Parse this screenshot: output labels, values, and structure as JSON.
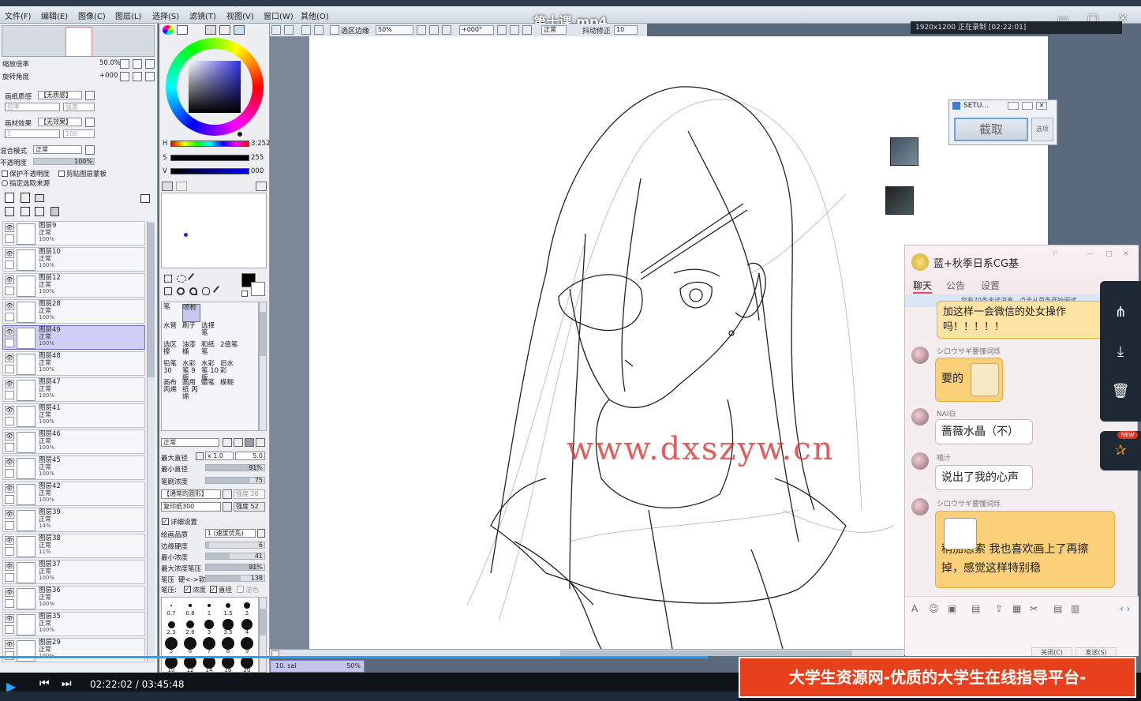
{
  "window": {
    "video_title": "第十课.mp4",
    "minimize": "▭",
    "maximize": "□",
    "close": "✕"
  },
  "menu": [
    "文件(F)",
    "编辑(E)",
    "图像(C)",
    "图层(L)",
    "选择(S)",
    "滤镜(T)",
    "视图(V)",
    "窗口(W)",
    "其他(O)"
  ],
  "toolbar": {
    "select_edge": "选区边缘",
    "zoom": "50%",
    "rotation": "+000°",
    "mode": "正常",
    "stabilizer_label": "抖动修正",
    "stabilizer_value": "10"
  },
  "recorder": {
    "text": "1920x1200  正在录制 [02:22:01]"
  },
  "navigator": {
    "zoom_label": "缩放倍率",
    "zoom_value": "50.0%",
    "rotate_label": "旋转角度",
    "rotate_value": "+000"
  },
  "paper": {
    "texture_label": "画纸质感",
    "texture_value": "【无质感】",
    "scale_label": "倍率",
    "scale_value": "100%",
    "strength_label": "强度",
    "strength_value": "20",
    "effect_label": "画材效果",
    "effect_value": "【无效果】",
    "effect_scale_value": "1",
    "effect_strength_value": "100"
  },
  "blend": {
    "mode_label": "混合模式",
    "mode_value": "正常",
    "opacity_label": "不透明度",
    "opacity_value": "100%",
    "protect": "保护不透明度",
    "clip": "剪贴图层蒙板",
    "source": "指定选取来源"
  },
  "layers": [
    {
      "name": "图层9",
      "mode": "正常",
      "op": "100%",
      "sel": false
    },
    {
      "name": "图层10",
      "mode": "正常",
      "op": "100%",
      "sel": false
    },
    {
      "name": "图层12",
      "mode": "正常",
      "op": "100%",
      "sel": false
    },
    {
      "name": "图层28",
      "mode": "正常",
      "op": "100%",
      "sel": false
    },
    {
      "name": "图层49",
      "mode": "正常",
      "op": "100%",
      "sel": true
    },
    {
      "name": "图层48",
      "mode": "正常",
      "op": "100%",
      "sel": false
    },
    {
      "name": "图层47",
      "mode": "正常",
      "op": "100%",
      "sel": false
    },
    {
      "name": "图层41",
      "mode": "正常",
      "op": "100%",
      "sel": false
    },
    {
      "name": "图层46",
      "mode": "正常",
      "op": "100%",
      "sel": false
    },
    {
      "name": "图层45",
      "mode": "正常",
      "op": "100%",
      "sel": false
    },
    {
      "name": "图层42",
      "mode": "正常",
      "op": "100%",
      "sel": false
    },
    {
      "name": "图层39",
      "mode": "正常",
      "op": "14%",
      "sel": false
    },
    {
      "name": "图层38",
      "mode": "正常",
      "op": "11%",
      "sel": false
    },
    {
      "name": "图层37",
      "mode": "正常",
      "op": "100%",
      "sel": false
    },
    {
      "name": "图层36",
      "mode": "正常",
      "op": "100%",
      "sel": false
    },
    {
      "name": "图层35",
      "mode": "正常",
      "op": "100%",
      "sel": false
    },
    {
      "name": "图层29",
      "mode": "正常",
      "op": "100%",
      "sel": false
    }
  ],
  "color": {
    "h_label": "H",
    "h_value": "3:252",
    "s_label": "S",
    "s_value": "255",
    "v_label": "V",
    "v_value": "000",
    "hue_marker": 0.7,
    "s_marker": 1.0,
    "v_marker": 0.0
  },
  "brushes": [
    [
      "笔",
      "喷枪",
      ""
    ],
    [
      "水管",
      "刷子",
      "选择笔"
    ],
    [
      "选区擦",
      "油漆桶",
      "和纸笔",
      "2值笔"
    ],
    [
      "铅笔30",
      "水彩笔 9版",
      "水彩笔 10版",
      "旧水彩"
    ],
    [
      "画布 丙烯",
      "画用纸 丙烯",
      "蜡笔",
      "模糊"
    ]
  ],
  "brush_settings": {
    "mode": "正常",
    "max_label": "最大直径",
    "max_mult": "x 1.0",
    "max_value": "5.0",
    "min_label": "最小直径",
    "min_value": "91%",
    "density_label": "笔刷浓度",
    "density_value": "75",
    "shape": "【通常的圆形】",
    "shape_strength_label": "强度",
    "shape_strength_value": "26",
    "texture": "复印纸300",
    "texture_strength_label": "强度",
    "texture_strength_value": "52",
    "detail": "详细设置",
    "quality_label": "绘画品质",
    "quality_value": "1 (速度优先)",
    "edge_label": "边缘硬度",
    "edge_value": "6",
    "min_density_label": "最小浓度",
    "min_density_value": "41",
    "max_pressure_label": "最大浓度笔压",
    "max_pressure_value": "91%",
    "pressure_label": "笔压",
    "pressure_hard": "硬<->软",
    "pressure_value": "138",
    "press_label": "笔压:",
    "press_density": "浓度",
    "press_size": "直径",
    "press_blend": "混色"
  },
  "brush_sizes": [
    "0.7",
    "0.8",
    "1",
    "1.5",
    "2",
    "2.3",
    "2.6",
    "3",
    "3.5",
    "4",
    "5",
    "6",
    "7",
    "8",
    "9",
    "10",
    "12",
    "14",
    "16",
    "20"
  ],
  "canvas": {
    "watermark": "www.dxszyw.cn",
    "doc_tab": "10. sai",
    "doc_zoom": "50%"
  },
  "setu": {
    "title": "SETU...",
    "capture": "截取",
    "options": "选项"
  },
  "chat": {
    "title": "蓝+秋季日系CG基",
    "tabs": [
      "聊天",
      "公告",
      "设置"
    ],
    "notice": "您有70条未读消息，点击从首条开始阅读。",
    "messages": [
      {
        "nick": "",
        "text": "加这样一会微信的处女操作 吗！！！！！"
      },
      {
        "nick": "シロウサギ要懂词烁",
        "text": "要的"
      },
      {
        "nick": "NAI白",
        "text": "蔷薇水晶（不）"
      },
      {
        "nick": "喵汁",
        "text": "说出了我的心声"
      },
      {
        "nick": "シロウサギ要懂词烁",
        "text": "稍加思索 我也喜欢画上了再擦掉，感觉这样特别稳"
      }
    ],
    "close_btn": "关闭(C)",
    "send_btn": "发送(S)"
  },
  "player": {
    "time": "02:22:02 / 03:45:48",
    "progress": 0.62
  },
  "banner": {
    "text": "大学生资源网-优质的大学生在线指导平台-www.dxszyw.cn"
  }
}
